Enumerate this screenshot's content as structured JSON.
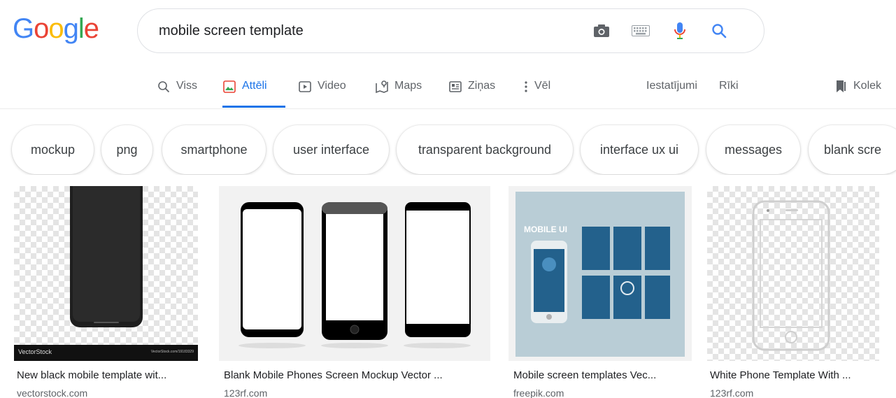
{
  "logo": {
    "letters": [
      "G",
      "o",
      "o",
      "g",
      "l",
      "e"
    ],
    "colors": [
      "#4285f4",
      "#ea4335",
      "#fbbc05",
      "#4285f4",
      "#34a853",
      "#ea4335"
    ]
  },
  "search": {
    "query": "mobile screen template",
    "icons": [
      "camera-icon",
      "keyboard-icon",
      "microphone-icon",
      "search-icon"
    ]
  },
  "tabs": [
    {
      "label": "Viss",
      "icon": "search-icon"
    },
    {
      "label": "Attēli",
      "icon": "image-icon",
      "active": true
    },
    {
      "label": "Video",
      "icon": "video-play-icon"
    },
    {
      "label": "Maps",
      "icon": "map-icon"
    },
    {
      "label": "Ziņas",
      "icon": "news-icon"
    },
    {
      "label": "Vēl",
      "icon": "more-vert-icon"
    }
  ],
  "tools": {
    "settings": "Iestatījumi",
    "tools": "Rīki",
    "collections": "Kolek"
  },
  "chips": [
    "mockup",
    "png",
    "smartphone",
    "user interface",
    "transparent background",
    "interface ux ui",
    "messages",
    "blank scre"
  ],
  "results": [
    {
      "title": "New black mobile template wit...",
      "site": "vectorstock.com",
      "watermark": "VectorStock",
      "watermark_small": "VectorStock.com/19183329"
    },
    {
      "title": "Blank Mobile Phones Screen Mockup Vector ...",
      "site": "123rf.com"
    },
    {
      "title": "Mobile screen templates Vec...",
      "site": "freepik.com",
      "banner": "MOBILE UI"
    },
    {
      "title": "White Phone Template With ...",
      "site": "123rf.com"
    }
  ],
  "colors": {
    "accent": "#1a73e8",
    "text": "#202124",
    "muted": "#5f6368"
  }
}
